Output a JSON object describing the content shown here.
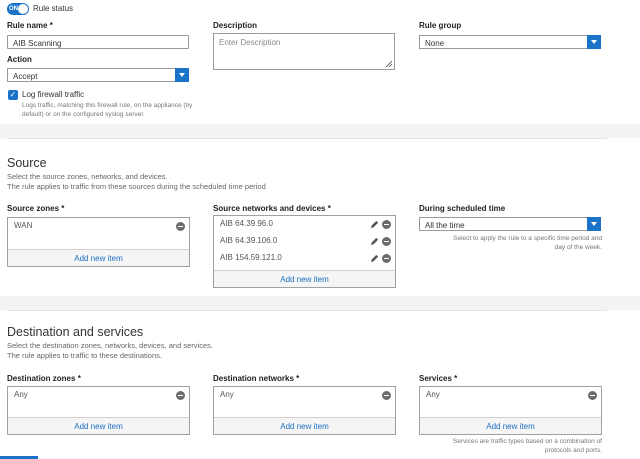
{
  "rule_status": {
    "toggle": "ON",
    "label": "Rule status"
  },
  "rule_name": {
    "label": "Rule name",
    "required": "*",
    "value": "AIB Scanning"
  },
  "description": {
    "label": "Description",
    "placeholder": "Enter Description"
  },
  "rule_group": {
    "label": "Rule group",
    "value": "None"
  },
  "action": {
    "label": "Action",
    "value": "Accept"
  },
  "log": {
    "label": "Log firewall traffic",
    "hint_line1": "Logs traffic, matching this firewall rule, on the appliance (by",
    "hint_line2": "default) or on the configured syslog server."
  },
  "source": {
    "title": "Source",
    "sub1": "Select the source zones, networks, and devices.",
    "sub2": "The rule applies to traffic from these sources during the scheduled time period",
    "zones": {
      "label": "Source zones",
      "required": "*",
      "items": [
        "WAN"
      ],
      "add": "Add new item"
    },
    "networks": {
      "label": "Source networks and devices",
      "required": "*",
      "items": [
        "AIB 64.39.96.0",
        "AIB 64.39.106.0",
        "AIB 154.59.121.0"
      ],
      "add": "Add new item"
    },
    "schedule": {
      "label": "During scheduled time",
      "value": "All the time",
      "hint_line1": "Select to apply the rule to a specific time period and",
      "hint_line2": "day of the week."
    }
  },
  "destination": {
    "title": "Destination and services",
    "sub1": "Select the destination zones, networks, devices, and services.",
    "sub2": "The rule applies to traffic to these destinations.",
    "zones": {
      "label": "Destination zones",
      "required": "*",
      "items": [
        "Any"
      ],
      "add": "Add new item"
    },
    "networks": {
      "label": "Destination networks",
      "required": "*",
      "items": [
        "Any"
      ],
      "add": "Add new item"
    },
    "services": {
      "label": "Services",
      "required": "*",
      "items": [
        "Any"
      ],
      "add": "Add new item",
      "hint_line1": "Services are traffic types based on a combination of",
      "hint_line2": "protocols and ports."
    }
  },
  "colors": {
    "accent": "#1a73c8",
    "link": "#1a6fc4",
    "band": "#f3f3f3"
  },
  "icons": [
    "minus-circle-icon",
    "pencil-icon",
    "chevron-down-icon",
    "check-icon"
  ]
}
